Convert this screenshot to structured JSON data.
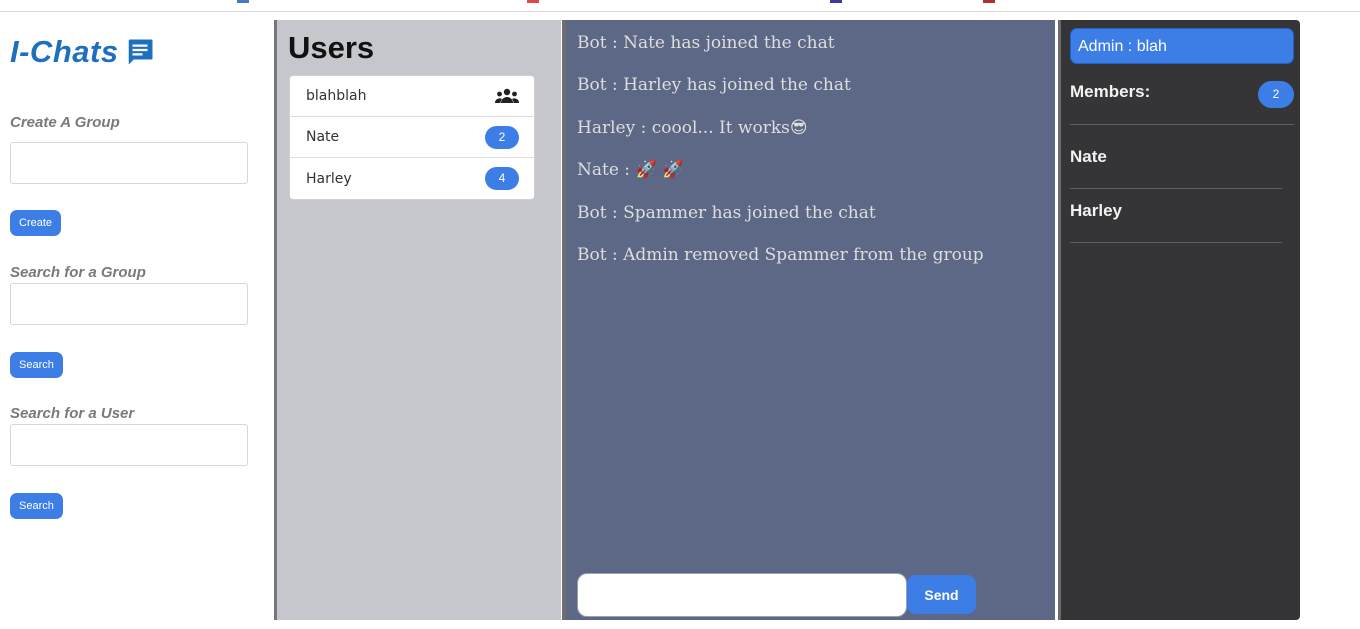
{
  "left_panel": {
    "brand": "I-Chats",
    "create_group_label": "Create A Group",
    "create_button": "Create",
    "search_group_label": "Search for a Group",
    "search_group_button": "Search",
    "search_user_label": "Search for a User",
    "search_user_button": "Search"
  },
  "users_panel": {
    "title": "Users",
    "items": [
      {
        "name": "blahblah",
        "icon": "users-group-icon"
      },
      {
        "name": "Nate",
        "badge": "2"
      },
      {
        "name": "Harley",
        "badge": "4"
      }
    ]
  },
  "chat_panel": {
    "messages": [
      {
        "text": "Bot : Nate has joined the chat"
      },
      {
        "text": "Bot : Harley has joined the chat"
      },
      {
        "text": "Harley : coool... It works",
        "emoji": "😎"
      },
      {
        "text": "Nate : ",
        "emoji": "🚀 🚀"
      },
      {
        "text": "Bot : Spammer has joined the chat"
      },
      {
        "text": "Bot : Admin removed Spammer from the group"
      }
    ],
    "send_button": "Send"
  },
  "members_panel": {
    "admin": "Admin : blah",
    "members_label": "Members:",
    "members_count": "2",
    "members": [
      "Nate",
      "Harley"
    ]
  },
  "colors": {
    "accent": "#3d7ee6",
    "brand": "#1f6fbf",
    "users_bg": "#c6c7cd",
    "chat_bg": "#5c6886",
    "members_bg": "#353537"
  }
}
